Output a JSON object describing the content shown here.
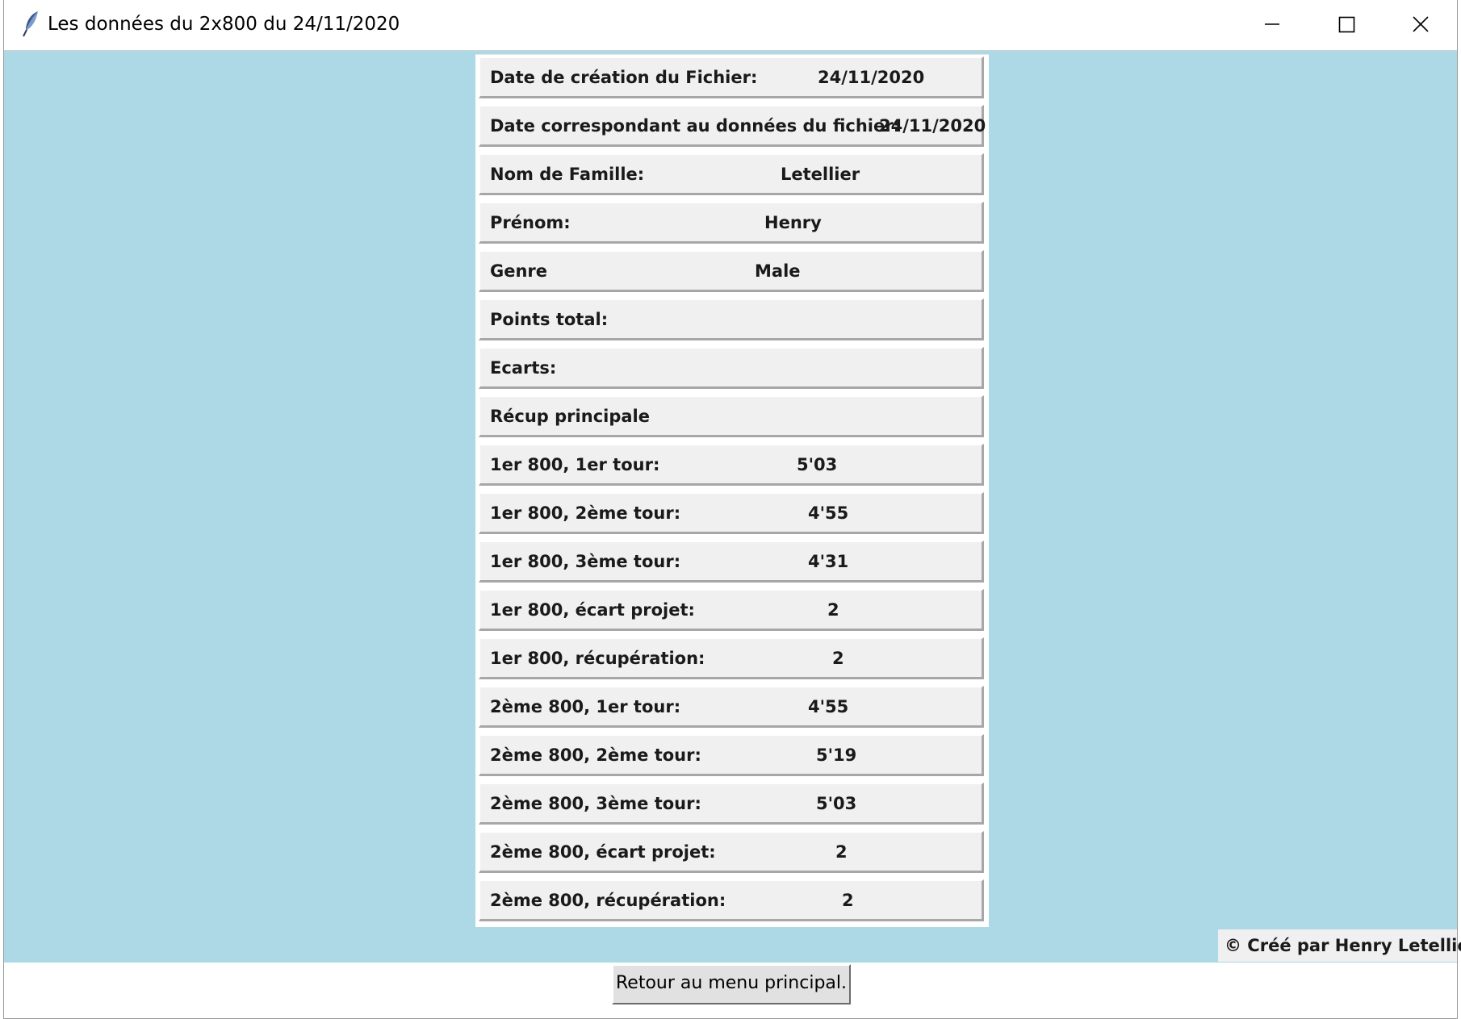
{
  "window": {
    "title": "Les données du 2x800 du 24/11/2020",
    "icon": "feather-icon",
    "controls": [
      "minimize-icon",
      "maximize-icon",
      "close-icon"
    ]
  },
  "colors": {
    "background": "#add8e6",
    "row": "#f0f0f0",
    "button": "#e1e1e1"
  },
  "rows": [
    {
      "label": "Date de création du Fichier:",
      "value": "24/11/2020"
    },
    {
      "label": "Date correspondant au données du fichier:",
      "value": "24/11/2020"
    },
    {
      "label": "Nom de Famille:",
      "value": "Letellier"
    },
    {
      "label": "Prénom:",
      "value": "Henry"
    },
    {
      "label": "Genre",
      "value": "Male"
    },
    {
      "label": "Points total:",
      "value": ""
    },
    {
      "label": "Ecarts:",
      "value": ""
    },
    {
      "label": "Récup principale",
      "value": ""
    },
    {
      "label": "1er 800, 1er tour:",
      "value": "5'03"
    },
    {
      "label": "1er 800, 2ème tour:",
      "value": "4'55"
    },
    {
      "label": "1er 800, 3ème tour:",
      "value": "4'31"
    },
    {
      "label": "1er 800, écart projet:",
      "value": "2"
    },
    {
      "label": "1er 800, récupération:",
      "value": "2"
    },
    {
      "label": "2ème 800, 1er tour:",
      "value": "4'55"
    },
    {
      "label": "2ème 800, 2ème tour:",
      "value": "5'19"
    },
    {
      "label": "2ème 800, 3ème tour:",
      "value": "5'03"
    },
    {
      "label": "2ème 800, écart projet:",
      "value": "2"
    },
    {
      "label": "2ème 800, récupération:",
      "value": "2"
    }
  ],
  "footer": {
    "credit": "© Créé par Henry Letellier",
    "back_button": "Retour au menu principal."
  }
}
